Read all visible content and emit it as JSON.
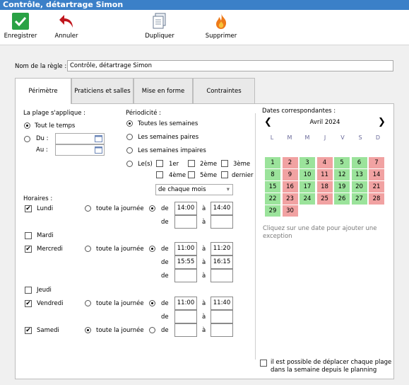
{
  "window": {
    "title": "Contrôle, détartrage Simon"
  },
  "toolbar": {
    "save": "Enregistrer",
    "cancel": "Annuler",
    "duplicate": "Dupliquer",
    "delete": "Supprimer"
  },
  "rule": {
    "label": "Nom de la règle :",
    "value": "Contrôle, détartrage Simon"
  },
  "tabs": [
    "Périmètre",
    "Praticiens et salles",
    "Mise en forme",
    "Contraintes"
  ],
  "range": {
    "title": "La plage s'applique :",
    "all_time": "Tout le temps",
    "from": "Du :",
    "to": "Au :"
  },
  "periodicity": {
    "title": "Périodicité :",
    "all_weeks": "Toutes les semaines",
    "even": "Les semaines paires",
    "odd": "Les semaines impaires",
    "the": "Le(s)",
    "first": "1er",
    "second": "2ème",
    "third": "3ème",
    "fourth": "4ème",
    "fifth": "5ème",
    "last": "dernier",
    "month_select": "de chaque mois"
  },
  "hours": {
    "title": "Horaires :",
    "all_day": "toute la journée",
    "from": "de",
    "to": "à",
    "days": [
      {
        "name": "Lundi",
        "checked": true,
        "allday": false,
        "ranges": [
          [
            "14:00",
            "14:40"
          ],
          [
            "",
            ""
          ]
        ]
      },
      {
        "name": "Mardi",
        "checked": false
      },
      {
        "name": "Mercredi",
        "checked": true,
        "allday": false,
        "ranges": [
          [
            "11:00",
            "11:20"
          ],
          [
            "15:55",
            "16:15"
          ],
          [
            "",
            ""
          ]
        ]
      },
      {
        "name": "Jeudi",
        "checked": false
      },
      {
        "name": "Vendredi",
        "checked": true,
        "allday": false,
        "ranges": [
          [
            "11:00",
            "11:40"
          ],
          [
            "",
            ""
          ]
        ]
      },
      {
        "name": "Samedi",
        "checked": true,
        "allday": true,
        "ranges": [
          [
            "",
            ""
          ]
        ]
      }
    ]
  },
  "calendar": {
    "title": "Dates correspondantes :",
    "month": "Avril 2024",
    "weekdays": [
      "L",
      "M",
      "M",
      "J",
      "V",
      "S",
      "D"
    ],
    "days": [
      {
        "d": "1",
        "c": "g"
      },
      {
        "d": "2",
        "c": "r"
      },
      {
        "d": "3",
        "c": "g"
      },
      {
        "d": "4",
        "c": "r"
      },
      {
        "d": "5",
        "c": "g"
      },
      {
        "d": "6",
        "c": "g"
      },
      {
        "d": "7",
        "c": "r"
      },
      {
        "d": "8",
        "c": "g"
      },
      {
        "d": "9",
        "c": "r"
      },
      {
        "d": "10",
        "c": "g"
      },
      {
        "d": "11",
        "c": "r"
      },
      {
        "d": "12",
        "c": "g"
      },
      {
        "d": "13",
        "c": "g"
      },
      {
        "d": "14",
        "c": "r"
      },
      {
        "d": "15",
        "c": "g"
      },
      {
        "d": "16",
        "c": "r"
      },
      {
        "d": "17",
        "c": "g"
      },
      {
        "d": "18",
        "c": "r"
      },
      {
        "d": "19",
        "c": "g"
      },
      {
        "d": "20",
        "c": "g"
      },
      {
        "d": "21",
        "c": "r"
      },
      {
        "d": "22",
        "c": "g"
      },
      {
        "d": "23",
        "c": "r"
      },
      {
        "d": "24",
        "c": "g"
      },
      {
        "d": "25",
        "c": "r"
      },
      {
        "d": "26",
        "c": "g"
      },
      {
        "d": "27",
        "c": "g"
      },
      {
        "d": "28",
        "c": "r"
      },
      {
        "d": "29",
        "c": "g"
      },
      {
        "d": "30",
        "c": "r"
      }
    ],
    "hint": "Cliquez sur une date pour ajouter une exception"
  },
  "move": {
    "label1": "il est possible de déplacer chaque plage",
    "label2": "dans la semaine depuis le planning"
  }
}
